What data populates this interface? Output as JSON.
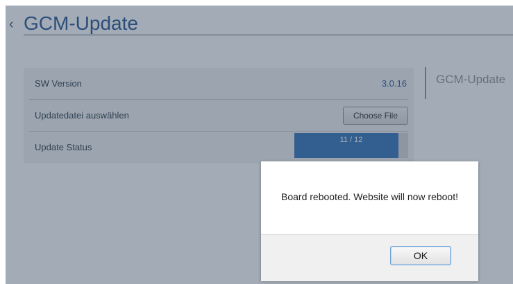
{
  "header": {
    "back_glyph": "‹",
    "title": "GCM-Update"
  },
  "panel": {
    "rows": [
      {
        "label": "SW Version",
        "value": "3.0.16"
      },
      {
        "label": "Updatedatei auswählen",
        "button": "Choose File"
      },
      {
        "label": "Update Status",
        "progress_text": "11 / 12",
        "progress_fraction": 0.917
      }
    ]
  },
  "side_nav": {
    "link": "GCM-Update"
  },
  "dialog": {
    "message": "Board rebooted. Website will now reboot!",
    "ok_label": "OK"
  },
  "colors": {
    "accent": "#1f4e8c",
    "progress": "#2c6db8"
  }
}
